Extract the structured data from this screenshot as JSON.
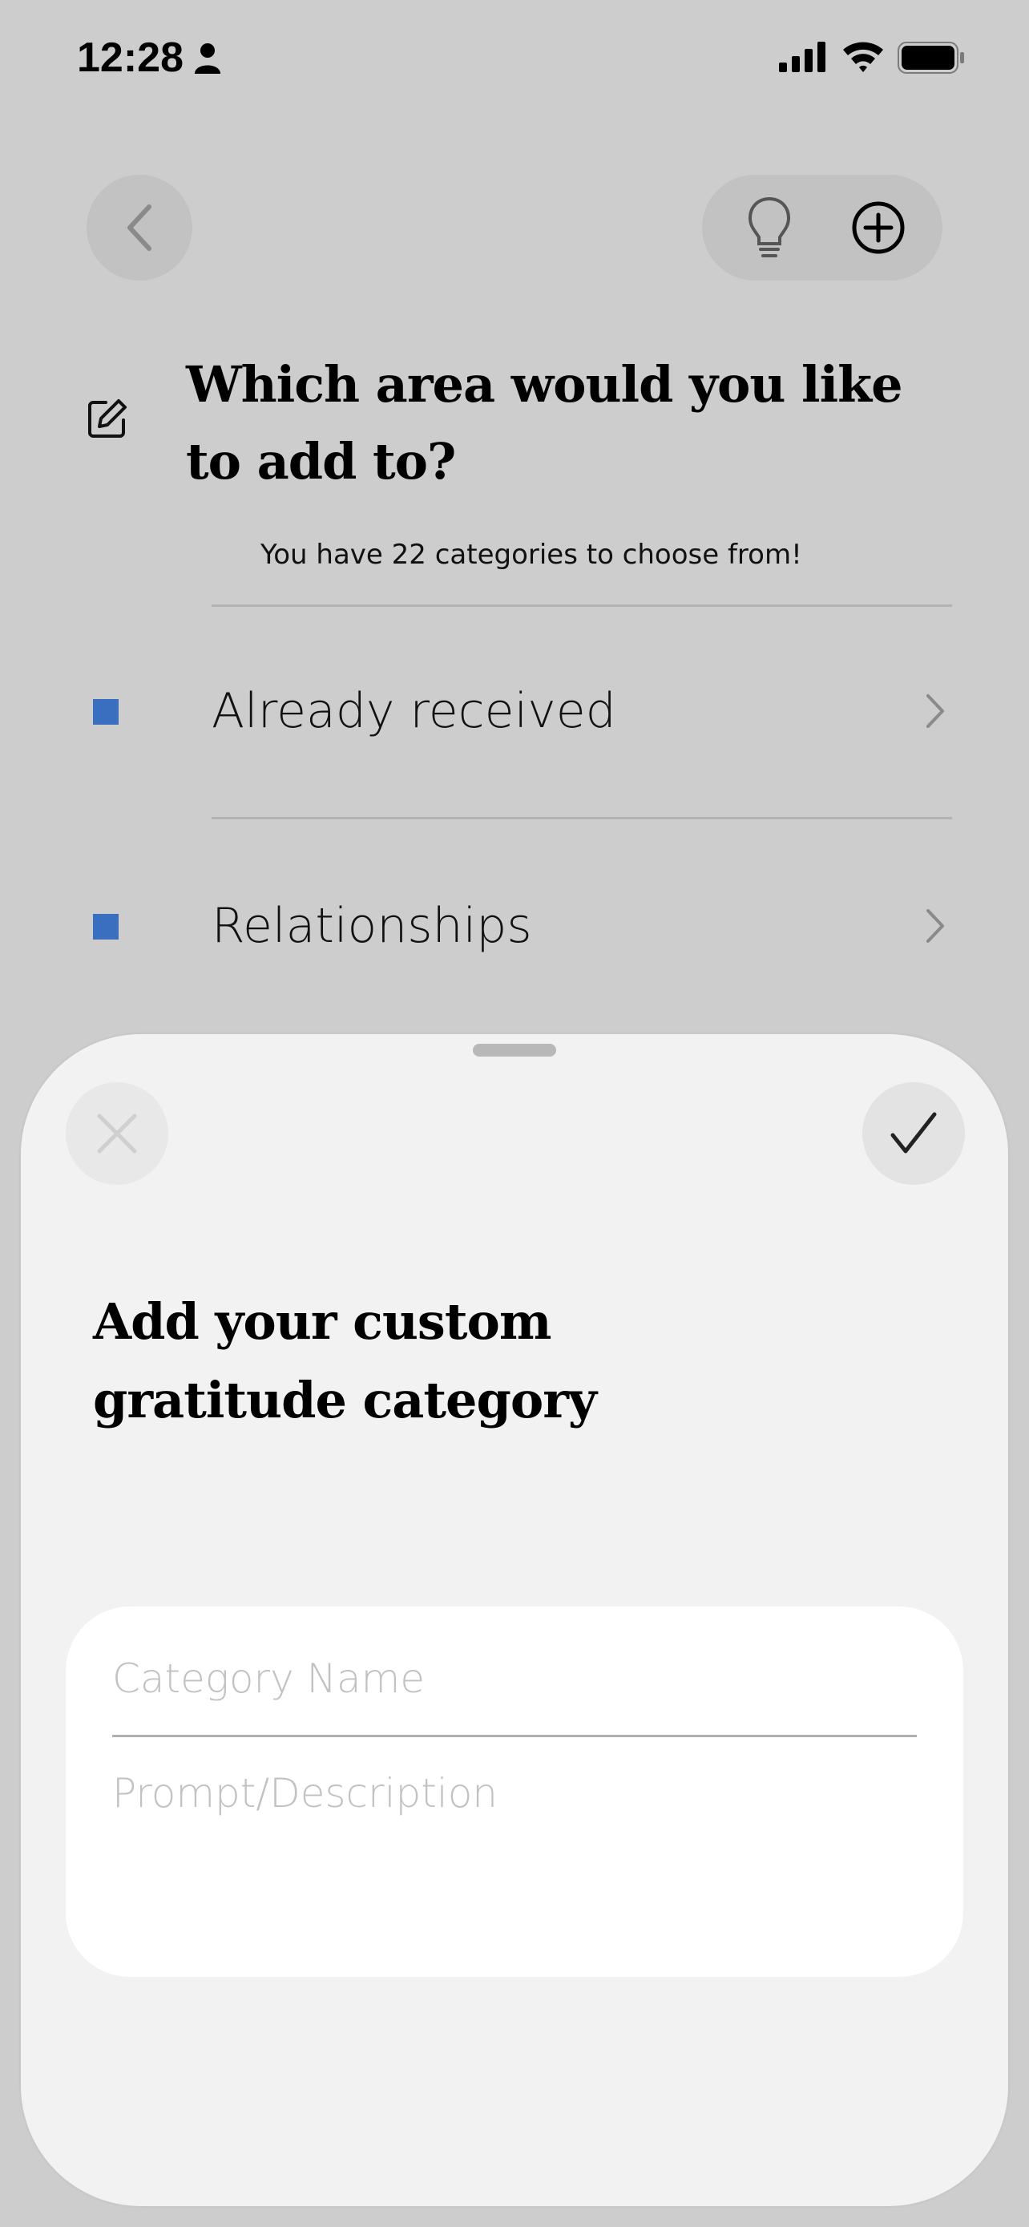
{
  "status_bar": {
    "time": "12:28",
    "icons": [
      "person-icon",
      "signal-icon",
      "wifi-icon",
      "battery-icon"
    ]
  },
  "header": {
    "back_icon": "chevron-left-icon",
    "actions": [
      "lightbulb-icon",
      "plus-circle-icon"
    ]
  },
  "page": {
    "title_icon": "edit-icon",
    "title": "Which area would you like to add to?",
    "subtitle": "You have 22 categories to choose from!",
    "categories": [
      {
        "label": "Already received",
        "color": "#3a6fbf"
      },
      {
        "label": "Relationships",
        "color": "#3a6fbf"
      }
    ]
  },
  "sheet": {
    "close_icon": "close-icon",
    "confirm_icon": "checkmark-icon",
    "title": "Add your custom gratitude category",
    "fields": {
      "name_placeholder": "Category Name",
      "name_value": "",
      "description_placeholder": "Prompt/Description",
      "description_value": ""
    }
  },
  "colors": {
    "background": "#cdcdcd",
    "sheet": "#f2f2f2",
    "accent": "#3a6fbf"
  }
}
